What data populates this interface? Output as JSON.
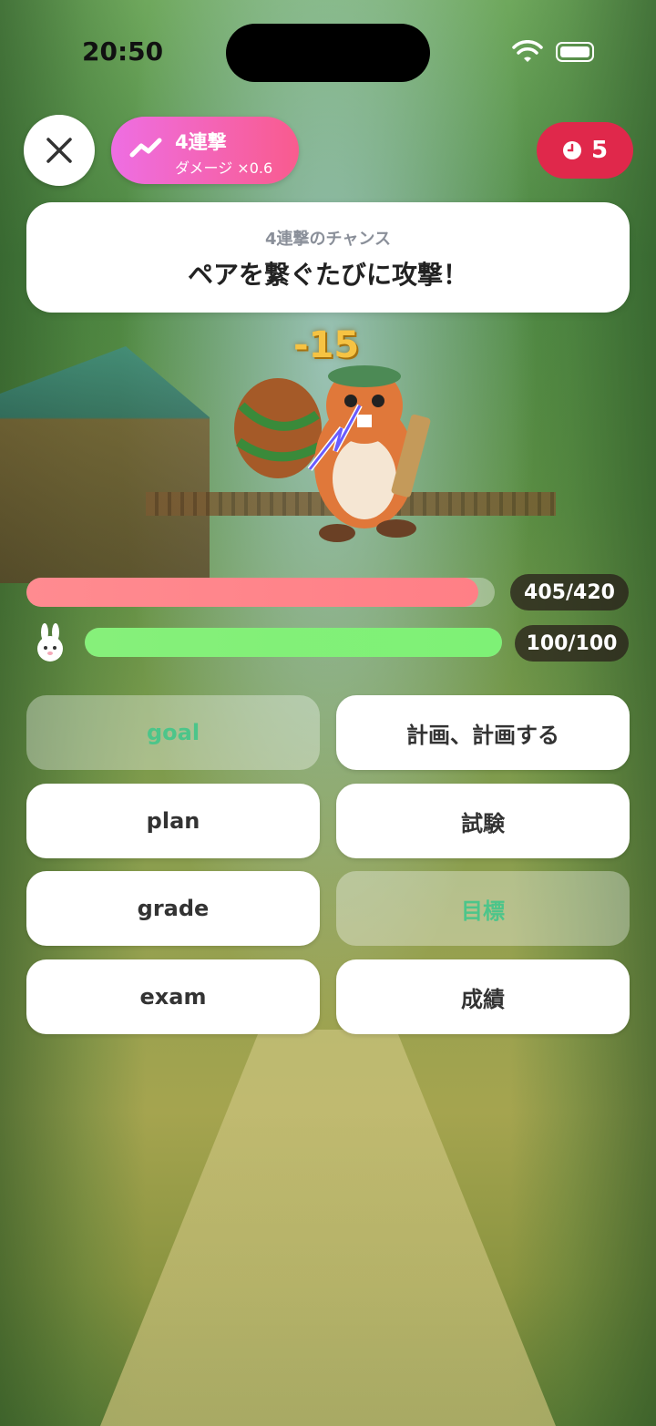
{
  "status_bar": {
    "time": "20:50"
  },
  "combo": {
    "title": "4連撃",
    "subtitle": "ダメージ ×0.6",
    "icon": "trend-icon"
  },
  "timer": {
    "value": "5",
    "icon": "clock-icon"
  },
  "prompt": {
    "subtitle": "4連撃のチャンス",
    "title": "ペアを繋ぐたびに攻撃！"
  },
  "battle": {
    "damage_text": "-15",
    "enemy_hp": {
      "current": 405,
      "max": 420,
      "label": "405/420"
    },
    "player_hp": {
      "current": 100,
      "max": 100,
      "label": "100/100"
    }
  },
  "cards": [
    {
      "label": "goal",
      "state": "matched"
    },
    {
      "label": "計画、計画する",
      "state": "normal"
    },
    {
      "label": "plan",
      "state": "normal"
    },
    {
      "label": "試験",
      "state": "normal"
    },
    {
      "label": "grade",
      "state": "normal"
    },
    {
      "label": "目標",
      "state": "matched"
    },
    {
      "label": "exam",
      "state": "normal"
    },
    {
      "label": "成績",
      "state": "normal"
    }
  ],
  "colors": {
    "enemy_hp": "#ff8b90",
    "player_hp": "#7ef176",
    "timer_bg": "#e0284b",
    "matched_text": "#4cc58a"
  }
}
